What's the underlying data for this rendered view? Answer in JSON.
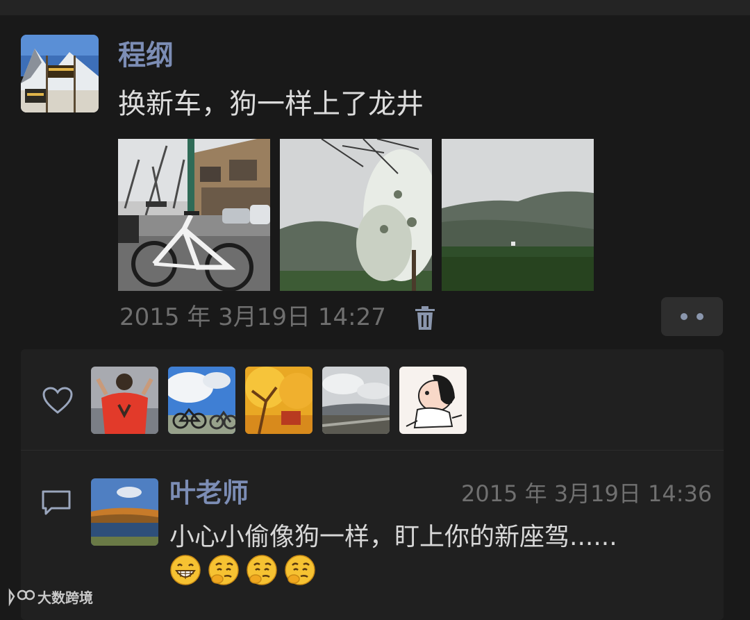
{
  "post": {
    "author": "程纲",
    "text": "换新车，狗一样上了龙井",
    "timestamp": "2015 年 3月19日 14:27",
    "photos": [
      "bike-street-photo",
      "magnolia-hills-photo",
      "tea-field-hills-photo"
    ],
    "delete_icon": "trash-icon",
    "more_icon": "two-dots-icon"
  },
  "likes": {
    "icon": "heart-icon",
    "avatars": [
      "liker-red-shirt",
      "liker-bicycles",
      "liker-autumn-tree",
      "liker-cloudy-field",
      "liker-cartoon"
    ]
  },
  "comments": [
    {
      "icon": "comment-bubble-icon",
      "author": "叶老师",
      "timestamp": "2015 年 3月19日 14:36",
      "text": "小心小偷像狗一样，盯上你的新座驾......",
      "emojis": [
        "grin-emoji",
        "hmm-emoji",
        "hmm-emoji",
        "hmm-emoji"
      ]
    }
  ],
  "watermark": {
    "text": "大数跨境"
  },
  "colors": {
    "background": "#191919",
    "panel": "#202020",
    "name": "#7c8db5",
    "time": "#6f6f6f"
  }
}
